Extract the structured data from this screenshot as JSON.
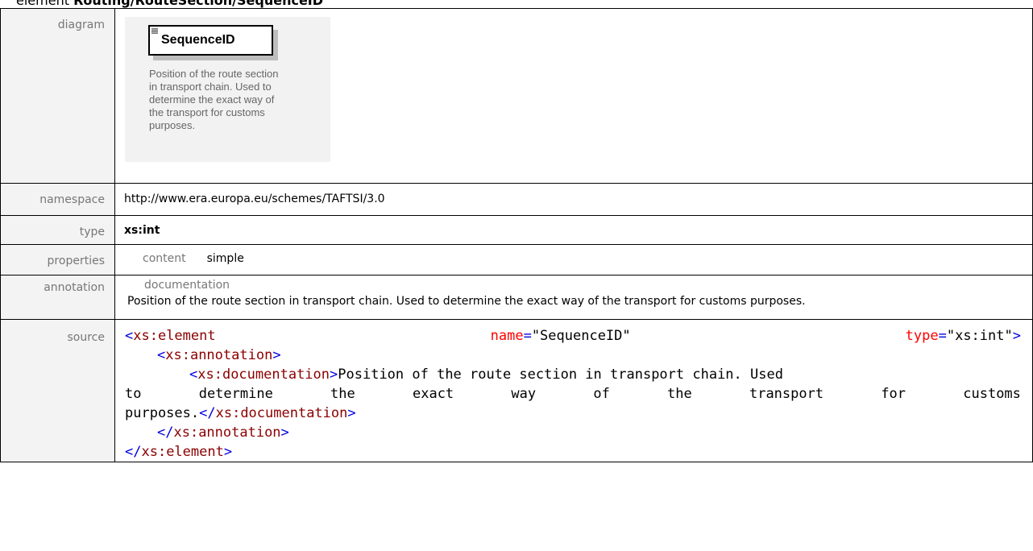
{
  "heading": {
    "prefix": "element ",
    "path": "Routing/RouteSection/SequenceID"
  },
  "labels": {
    "diagram": "diagram",
    "namespace": "namespace",
    "type": "type",
    "properties": "properties",
    "annotation": "annotation",
    "source": "source"
  },
  "diagram": {
    "node_title": "SequenceID",
    "description": "Position of the route section in transport chain. Used to determine the exact way of the transport for customs purposes."
  },
  "namespace": "http://www.era.europa.eu/schemes/TAFTSI/3.0",
  "type": "xs:int",
  "properties": {
    "key": "content",
    "value": "simple"
  },
  "annotation": {
    "title": "documentation",
    "text": "Position of the route section in transport chain. Used to determine the exact way of the transport for customs purposes."
  },
  "source": {
    "line1_open": "<",
    "line1_tag": "xs:element",
    "line1_attr1": "name",
    "line1_eq1": "=",
    "line1_val1": "\"SequenceID\"",
    "line1_attr2": "type",
    "line1_eq2": "=",
    "line1_val2": "\"xs:int\"",
    "line1_close": ">",
    "line2_open": "<",
    "line2_tag": "xs:annotation",
    "line2_close": ">",
    "line3_open": "<",
    "line3_tag": "xs:documentation",
    "line3_close": ">",
    "line3_text": "Position of the route section in transport chain. Used",
    "line4_words": [
      "to",
      "determine",
      "the",
      "exact",
      "way",
      "of",
      "the",
      "transport",
      "for",
      "customs"
    ],
    "line5_text": "purposes.",
    "line5_endopen": "</",
    "line5_endtag": "xs:documentation",
    "line5_endclose": ">",
    "line6_endopen": "</",
    "line6_endtag": "xs:annotation",
    "line6_endclose": ">",
    "line7_endopen": "</",
    "line7_endtag": "xs:element",
    "line7_endclose": ">"
  },
  "colors": {
    "label_bg": "#f3f3f3",
    "tag_bracket": "#0000e0",
    "tag_name": "#8b0000",
    "attribute": "#ff0000"
  }
}
